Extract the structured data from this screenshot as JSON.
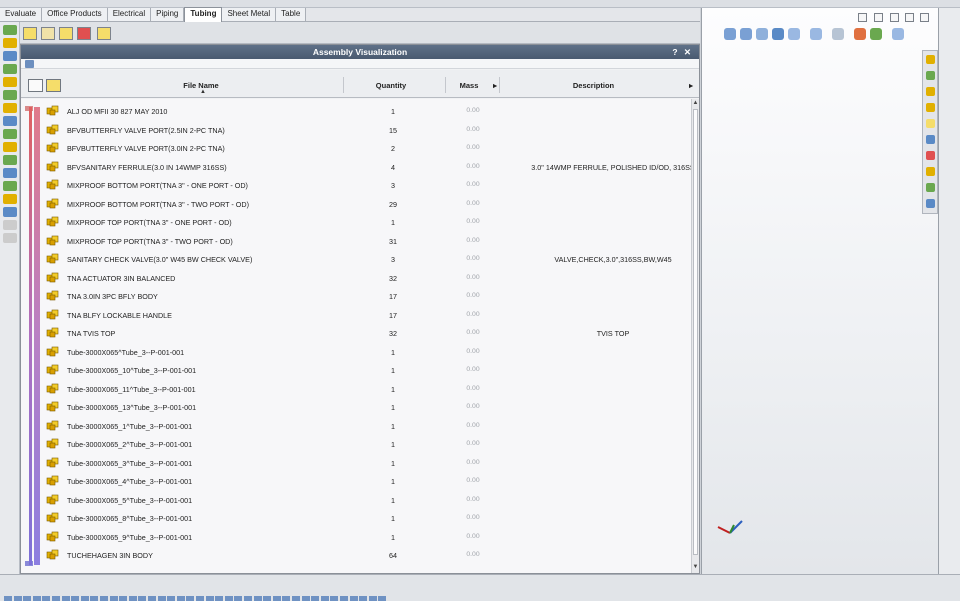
{
  "tabs": [
    "Evaluate",
    "Office Products",
    "Electrical",
    "Piping",
    "Tubing",
    "Sheet Metal",
    "Table"
  ],
  "active_tab": "Tubing",
  "panel": {
    "title": "Assembly Visualization",
    "title_controls": "? ✕",
    "columns": {
      "file_name": "File Name",
      "quantity": "Quantity",
      "mass": "Mass",
      "description": "Description"
    },
    "rows": [
      {
        "name": "ALJ OD MFII 30 827 MAY 2010",
        "qty": "1",
        "mass": "0.00",
        "desc": ""
      },
      {
        "name": "BFVBUTTERFLY VALVE PORT(2.5IN 2-PC TNA)",
        "qty": "15",
        "mass": "0.00",
        "desc": ""
      },
      {
        "name": "BFVBUTTERFLY VALVE PORT(3.0IN 2-PC TNA)",
        "qty": "2",
        "mass": "0.00",
        "desc": ""
      },
      {
        "name": "BFVSANITARY FERRULE(3.0 IN 14WMP 316SS)",
        "qty": "4",
        "mass": "0.00",
        "desc": "3.0\" 14WMP FERRULE, POLISHED ID/OD, 316SS"
      },
      {
        "name": "MIXPROOF BOTTOM PORT(TNA 3\" - ONE PORT - OD)",
        "qty": "3",
        "mass": "0.00",
        "desc": ""
      },
      {
        "name": "MIXPROOF BOTTOM PORT(TNA 3\" - TWO PORT - OD)",
        "qty": "29",
        "mass": "0.00",
        "desc": ""
      },
      {
        "name": "MIXPROOF TOP PORT(TNA 3\" - ONE PORT - OD)",
        "qty": "1",
        "mass": "0.00",
        "desc": ""
      },
      {
        "name": "MIXPROOF TOP PORT(TNA 3\" - TWO PORT - OD)",
        "qty": "31",
        "mass": "0.00",
        "desc": ""
      },
      {
        "name": "SANITARY CHECK VALVE(3.0\" W45 BW CHECK VALVE)",
        "qty": "3",
        "mass": "0.00",
        "desc": "VALVE,CHECK,3.0\",316SS,BW,W45"
      },
      {
        "name": "TNA ACTUATOR 3IN BALANCED",
        "qty": "32",
        "mass": "0.00",
        "desc": ""
      },
      {
        "name": "TNA 3.0IN 3PC BFLY BODY",
        "qty": "17",
        "mass": "0.00",
        "desc": ""
      },
      {
        "name": "TNA BLFY LOCKABLE HANDLE",
        "qty": "17",
        "mass": "0.00",
        "desc": ""
      },
      {
        "name": "TNA TVIS TOP",
        "qty": "32",
        "mass": "0.00",
        "desc": "TVIS TOP"
      },
      {
        "name": "Tube-3000X065^Tube_3--P-001-001",
        "qty": "1",
        "mass": "0.00",
        "desc": ""
      },
      {
        "name": "Tube-3000X065_10^Tube_3--P-001-001",
        "qty": "1",
        "mass": "0.00",
        "desc": ""
      },
      {
        "name": "Tube-3000X065_11^Tube_3--P-001-001",
        "qty": "1",
        "mass": "0.00",
        "desc": ""
      },
      {
        "name": "Tube-3000X065_13^Tube_3--P-001-001",
        "qty": "1",
        "mass": "0.00",
        "desc": ""
      },
      {
        "name": "Tube-3000X065_1^Tube_3--P-001-001",
        "qty": "1",
        "mass": "0.00",
        "desc": ""
      },
      {
        "name": "Tube-3000X065_2^Tube_3--P-001-001",
        "qty": "1",
        "mass": "0.00",
        "desc": ""
      },
      {
        "name": "Tube-3000X065_3^Tube_3--P-001-001",
        "qty": "1",
        "mass": "0.00",
        "desc": ""
      },
      {
        "name": "Tube-3000X065_4^Tube_3--P-001-001",
        "qty": "1",
        "mass": "0.00",
        "desc": ""
      },
      {
        "name": "Tube-3000X065_5^Tube_3--P-001-001",
        "qty": "1",
        "mass": "0.00",
        "desc": ""
      },
      {
        "name": "Tube-3000X065_8^Tube_3--P-001-001",
        "qty": "1",
        "mass": "0.00",
        "desc": ""
      },
      {
        "name": "Tube-3000X065_9^Tube_3--P-001-001",
        "qty": "1",
        "mass": "0.00",
        "desc": ""
      },
      {
        "name": "TUCHEHAGEN 3IN BODY",
        "qty": "64",
        "mass": "0.00",
        "desc": ""
      }
    ]
  },
  "colors": {
    "title_bar": "#4f6079",
    "accent_red": "#e06060",
    "accent_blue": "#7c70d8",
    "part_icon": "#e1b000"
  }
}
